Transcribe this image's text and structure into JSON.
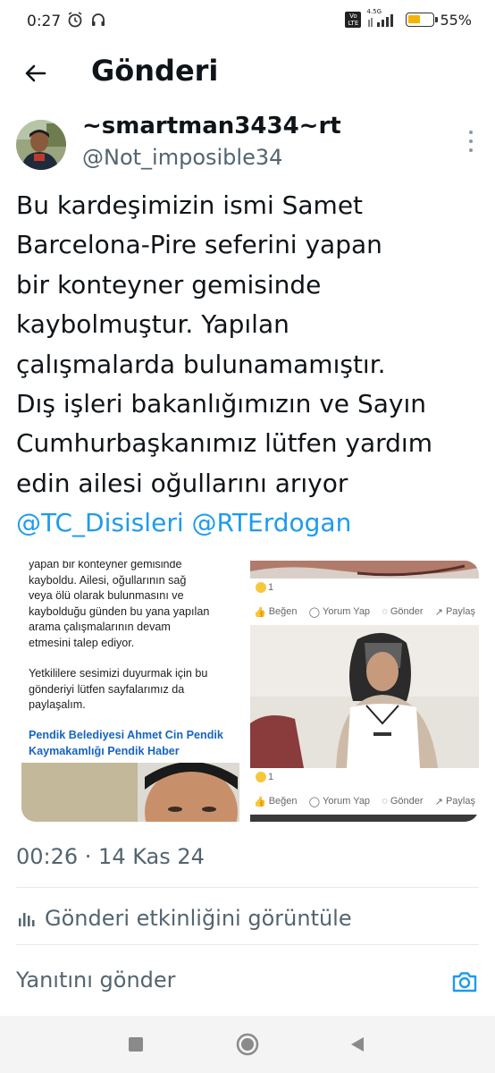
{
  "status_bar": {
    "time": "0:27",
    "network": "4.5G",
    "volte": "Vo LTE",
    "battery_percent": "55%",
    "battery_level": 0.55
  },
  "header": {
    "title": "Gönderi",
    "back_icon": "arrow-left-icon"
  },
  "tweet": {
    "display_name": "~smartman3434~rt",
    "handle": "@Not_imposible34",
    "text_lines": [
      "Bu kardeşimizin ismi Samet",
      "Barcelona-Pire  seferini yapan",
      "bir konteyner gemisinde",
      "kaybolmuştur. Yapılan",
      "çalışmalarda bulunamamıştır.",
      "Dış işleri bakanlığımızın ve Sayın",
      "Cumhurbaşkanımız lütfen yardım",
      "edin ailesi oğullarını arıyor"
    ],
    "mentions": [
      "@TC_Disisleri",
      "@RTErdogan"
    ],
    "timestamp": "00:26 · 14 Kas 24",
    "activity_label": "Gönderi etkinliğini görüntüle"
  },
  "media": {
    "left_text_lines": [
      "yapan bir konteyner gemisinde",
      "kayboldu. Ailesi, oğullarının sağ",
      "veya ölü olarak bulunmasını ve",
      "kaybolduğu günden bu yana yapılan",
      "arama çalışmalarının devam",
      "etmesini talep ediyor.",
      "",
      "Yetkililere sesimizi duyurmak için bu",
      "gönderiyi lütfen sayfalarımız da",
      "paylaşalım."
    ],
    "left_link_lines": [
      "Pendik Belediyesi Ahmet Cin Pendik",
      "Kaymakamlığı Pendik Haber"
    ],
    "reaction_count_top": "1",
    "reaction_count_bottom": "1",
    "actions": {
      "like": "Beğen",
      "comment": "Yorum Yap",
      "send": "Gönder",
      "share": "Paylaş"
    }
  },
  "reply": {
    "placeholder": "Yanıtını gönder",
    "camera_icon": "camera-icon"
  },
  "colors": {
    "accent": "#1d9bf0",
    "text": "#0f1419",
    "muted": "#536471"
  }
}
